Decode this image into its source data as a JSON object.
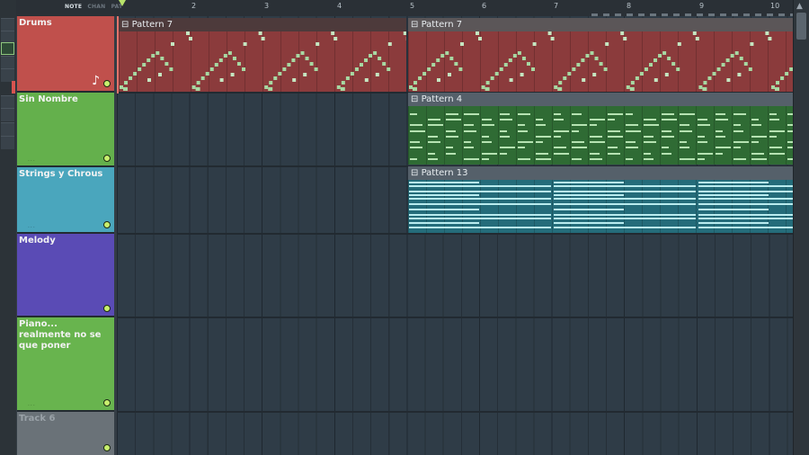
{
  "colors": {
    "drums": "#c0504c",
    "sin_nombre": "#64b04c",
    "strings": "#4aa6bd",
    "melody": "#5a4bb5",
    "piano": "#68b44e",
    "track6": "#6a7278"
  },
  "ruler": {
    "modes": [
      "NOTE",
      "CHAN",
      "PAT"
    ],
    "bars": [
      "2",
      "3",
      "4",
      "5",
      "6",
      "7",
      "8",
      "9",
      "10"
    ]
  },
  "tracks": [
    {
      "name": "Drums"
    },
    {
      "name": "Sin Nombre"
    },
    {
      "name": "Strings y Chrous"
    },
    {
      "name": "Melody"
    },
    {
      "name": "Piano... realmente no se que poner"
    },
    {
      "name": "Track 6"
    }
  ],
  "clips": {
    "drums_a": "Pattern 7",
    "drums_b": "Pattern 7",
    "sin_nombre": "Pattern 4",
    "strings": "Pattern 13"
  },
  "icons": {
    "note": "♪",
    "clip_handle": "⊟",
    "scroll_up": "▲"
  }
}
